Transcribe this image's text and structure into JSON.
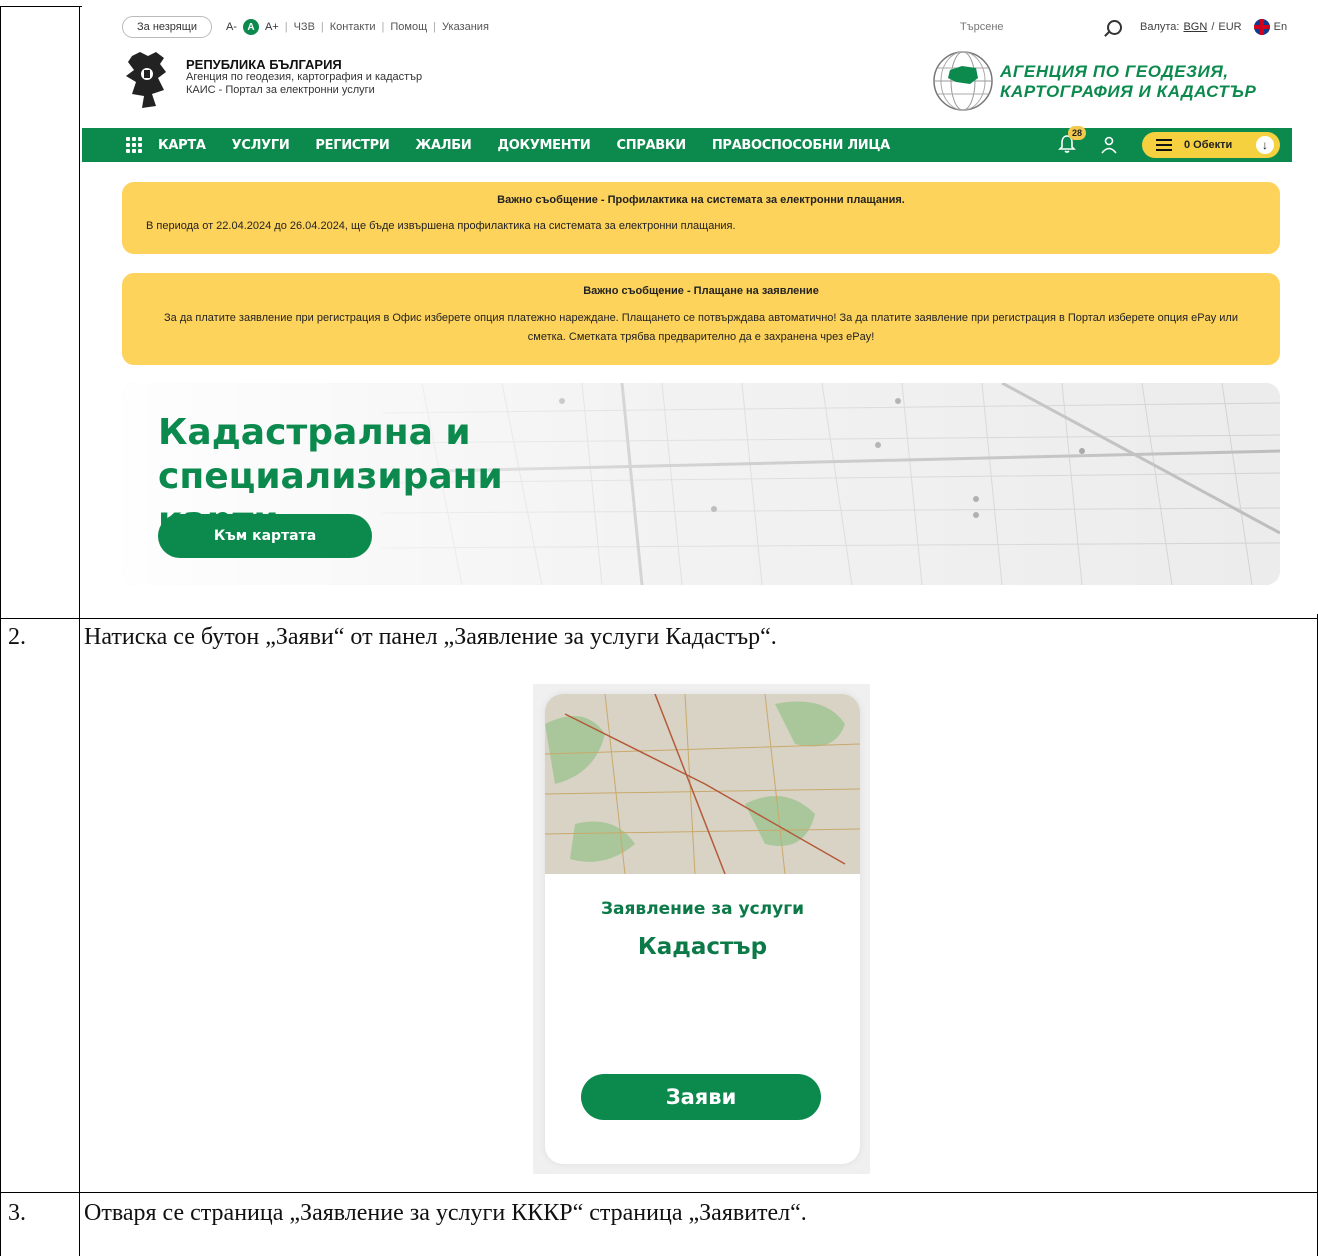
{
  "topbar": {
    "accessibility": "За незрящи",
    "font_smaller": "A-",
    "font_normal": "A",
    "font_larger": "A+",
    "links": [
      "ЧЗВ",
      "Контакти",
      "Помощ",
      "Указания"
    ],
    "search_placeholder": "Търсене",
    "currency_label": "Валута:",
    "currency_bgn": "BGN",
    "currency_eur": "EUR",
    "language": "En"
  },
  "header": {
    "gov_title": "РЕПУБЛИКА БЪЛГАРИЯ",
    "gov_agency": "Агенция по геодезия, картография и кадастър",
    "gov_portal": "КАИС - Портал за електронни услуги",
    "agency_line1": "АГЕНЦИЯ ПО ГЕОДЕЗИЯ,",
    "agency_line2": "КАРТОГРАФИЯ И КАДАСТЪР"
  },
  "nav": {
    "items": [
      "КАРТА",
      "УСЛУГИ",
      "РЕГИСТРИ",
      "ЖАЛБИ",
      "ДОКУМЕНТИ",
      "СПРАВКИ",
      "ПРАВОСПОСОБНИ ЛИЦА"
    ],
    "notifications_count": "28",
    "objects_label": "0 Обекти"
  },
  "notices": [
    {
      "title": "Важно съобщение - Профилактика на системата за електронни плащания.",
      "body": "В периода от 22.04.2024 до 26.04.2024, ще бъде извършена профилактика на системата за електронни плащания."
    },
    {
      "title": "Важно съобщение - Плащане на заявление",
      "body": "За да платите заявление при регистрация в Офис изберете опция  платежно нареждане. Плащането се потвърждава автоматично! За да платите заявление при регистрация в Портал изберете опция ePay или сметка. Сметката трябва предварително да е захранена чрез ePay!"
    }
  ],
  "hero": {
    "title": "Кадастрална и специализирани карти",
    "button": "Към картата"
  },
  "steps": [
    {
      "number": "2.",
      "text": "Натиска се бутон „Заяви“ от панел „Заявление за услуги Кадастър“."
    },
    {
      "number": "3.",
      "text": "Отваря се страница „Заявление за услуги КККР“ страница „Заявител“."
    }
  ],
  "card": {
    "subtitle": "Заявление за услуги",
    "title": "Кадастър",
    "button": "Заяви"
  },
  "colors": {
    "brand_green": "#0c8a4e",
    "notice_yellow": "#fdd35c"
  }
}
